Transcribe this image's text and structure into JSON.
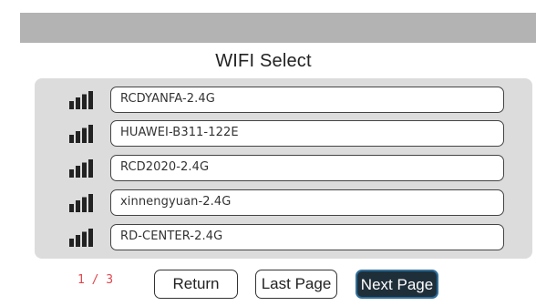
{
  "dialog": {
    "title": "WIFI Select"
  },
  "networks": [
    {
      "ssid": "RCDYANFA-2.4G",
      "signal_icon": "signal-bars-icon"
    },
    {
      "ssid": "HUAWEI-B311-122E",
      "signal_icon": "signal-bars-icon"
    },
    {
      "ssid": "RCD2020-2.4G",
      "signal_icon": "signal-bars-icon"
    },
    {
      "ssid": "xinnengyuan-2.4G",
      "signal_icon": "signal-bars-icon"
    },
    {
      "ssid": "RD-CENTER-2.4G",
      "signal_icon": "signal-bars-icon"
    }
  ],
  "pagination": {
    "indicator": "1 / 3",
    "return_label": "Return",
    "last_label": "Last Page",
    "next_label": "Next Page"
  },
  "colors": {
    "title_bar": "#b3b3b3",
    "list_background": "#dcdcdc",
    "page_indicator": "#e0474c",
    "next_button_bg": "#1f2f3a",
    "next_button_border": "#2f6f9c"
  }
}
